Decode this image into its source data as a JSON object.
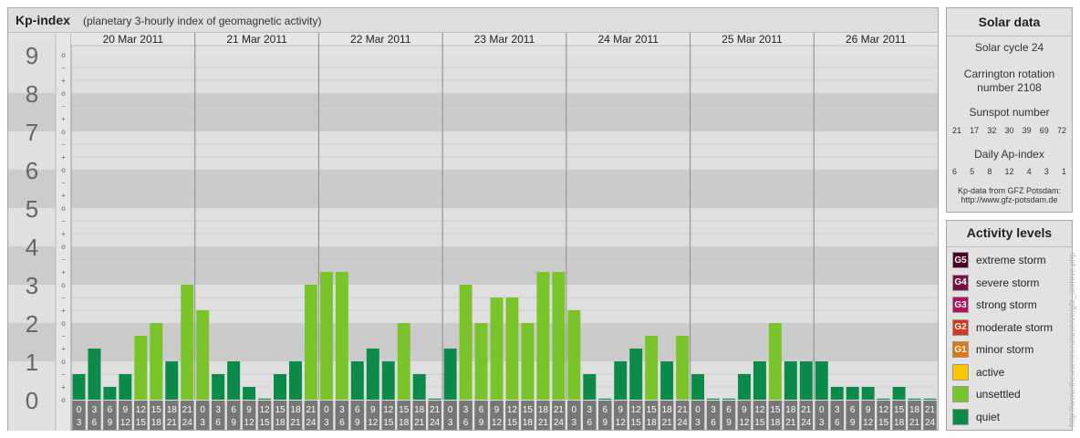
{
  "header": {
    "title": "Kp-index",
    "subtitle": "(planetary 3-hourly index of geomagnetic activity)"
  },
  "chart_data": {
    "type": "bar",
    "y_ticks": [
      "0",
      "1",
      "2",
      "3",
      "4",
      "5",
      "6",
      "7",
      "8",
      "9"
    ],
    "minor_ticks": [
      "+",
      "o",
      "−"
    ],
    "interval_labels": [
      [
        "0",
        "3"
      ],
      [
        "3",
        "6"
      ],
      [
        "6",
        "9"
      ],
      [
        "9",
        "12"
      ],
      [
        "12",
        "15"
      ],
      [
        "15",
        "18"
      ],
      [
        "18",
        "21"
      ],
      [
        "21",
        "24"
      ]
    ],
    "ylim": [
      0,
      9.33
    ],
    "days": [
      {
        "date": "20 Mar 2011",
        "values": [
          0.667,
          1.333,
          0.333,
          0.667,
          1.667,
          2.0,
          1.0,
          3.0
        ]
      },
      {
        "date": "21 Mar 2011",
        "values": [
          2.333,
          0.667,
          1.0,
          0.333,
          0.0,
          0.667,
          1.0,
          3.0
        ]
      },
      {
        "date": "22 Mar 2011",
        "values": [
          3.333,
          3.333,
          1.0,
          1.333,
          1.0,
          2.0,
          0.667,
          0.0
        ]
      },
      {
        "date": "23 Mar 2011",
        "values": [
          1.333,
          3.0,
          2.0,
          2.667,
          2.667,
          2.0,
          3.333,
          3.333
        ]
      },
      {
        "date": "24 Mar 2011",
        "values": [
          2.333,
          0.667,
          0.0,
          1.0,
          1.333,
          1.667,
          1.0,
          1.667
        ]
      },
      {
        "date": "25 Mar 2011",
        "values": [
          0.667,
          0.0,
          0.0,
          0.667,
          1.0,
          2.0,
          1.0,
          1.0
        ]
      },
      {
        "date": "26 Mar 2011",
        "values": [
          1.0,
          0.333,
          0.333,
          0.333,
          0.0,
          0.333,
          0.0,
          0.0
        ]
      }
    ],
    "level_colors": {
      "quiet": "#0b8a49",
      "unsettled": "#7ac32b",
      "active": "#f6c700",
      "minor": "#e07a10",
      "moderate": "#d63a1c",
      "strong": "#b0125e",
      "severe": "#741345",
      "extreme": "#4a0026"
    }
  },
  "solar": {
    "title": "Solar data",
    "cycle": "Solar cycle 24",
    "carrington_line1": "Carrington rotation",
    "carrington_line2": "number 2108",
    "sunspot_label": "Sunspot number",
    "sunspot_values": [
      "21",
      "17",
      "32",
      "30",
      "39",
      "69",
      "72"
    ],
    "ap_label": "Daily Ap-index",
    "ap_values": [
      "6",
      "5",
      "8",
      "12",
      "4",
      "3",
      "1"
    ],
    "source_line1": "Kp-data from GFZ Potsdam:",
    "source_line2": "http://www.gfz-potsdam.de"
  },
  "activity": {
    "title": "Activity levels",
    "levels": [
      {
        "badge": "G5",
        "label": "extreme storm",
        "color": "#4a0026"
      },
      {
        "badge": "G4",
        "label": "severe storm",
        "color": "#741345"
      },
      {
        "badge": "G3",
        "label": "strong storm",
        "color": "#b0125e"
      },
      {
        "badge": "G2",
        "label": "moderate storm",
        "color": "#d63a1c"
      },
      {
        "badge": "G1",
        "label": "minor storm",
        "color": "#e07a10"
      },
      {
        "badge": "",
        "label": "active",
        "color": "#f6c700"
      },
      {
        "badge": "",
        "label": "unsettled",
        "color": "#7ac32b"
      },
      {
        "badge": "",
        "label": "quiet",
        "color": "#0b8a49"
      }
    ]
  },
  "credit": "http://www.theusenet.ru/archive/gfz_archive.php"
}
